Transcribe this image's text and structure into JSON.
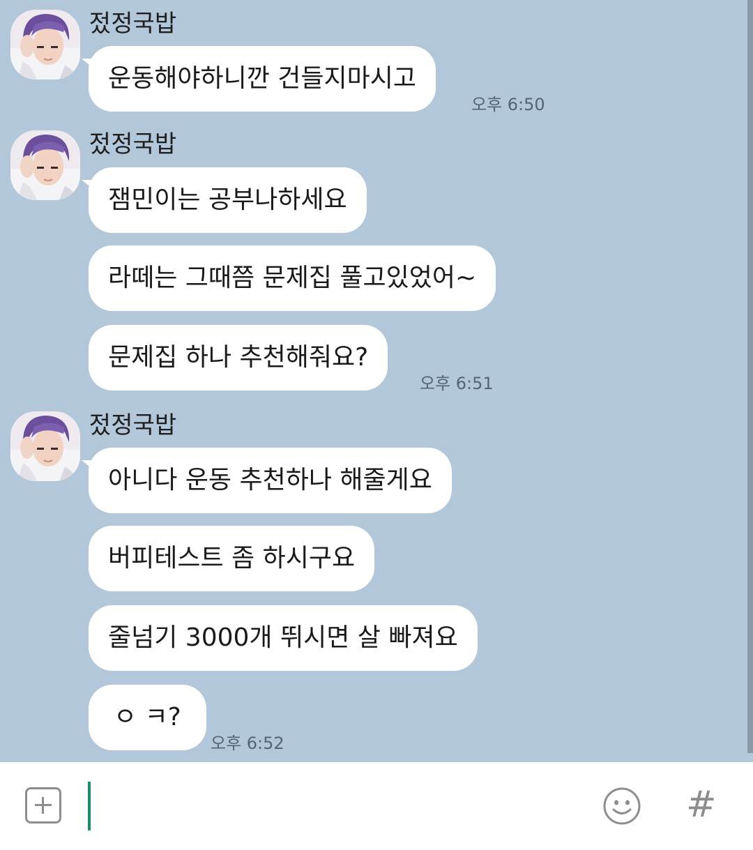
{
  "chat": {
    "groups": [
      {
        "sender": "젔정국밥",
        "messages": [
          "운동해야하니깐 건들지마시고"
        ],
        "time": "오후 6:50"
      },
      {
        "sender": "젔정국밥",
        "messages": [
          "잼민이는 공부나하세요",
          "라떼는 그때쯤 문제집 풀고있었어~",
          "문제집 하나 추천해줘요?"
        ],
        "time": "오후 6:51"
      },
      {
        "sender": "젔정국밥",
        "messages": [
          "아니다 운동 추천하나 해줄게요",
          "버피테스트 좀 하시구요",
          "줄넘기 3000개 뛰시면 살 빠져요",
          "ㅇ ㅋ?"
        ],
        "time": "오후 6:52"
      }
    ]
  },
  "input_bar": {
    "message_value": "",
    "hash_label": "#"
  },
  "colors": {
    "chat_background": "#b2c7d9",
    "bubble": "#ffffff",
    "cursor": "#1f8a70",
    "icon_gray": "#8d8d8d"
  },
  "icons": [
    "avatar",
    "plus-icon",
    "emoji-icon",
    "hashtag-icon"
  ]
}
